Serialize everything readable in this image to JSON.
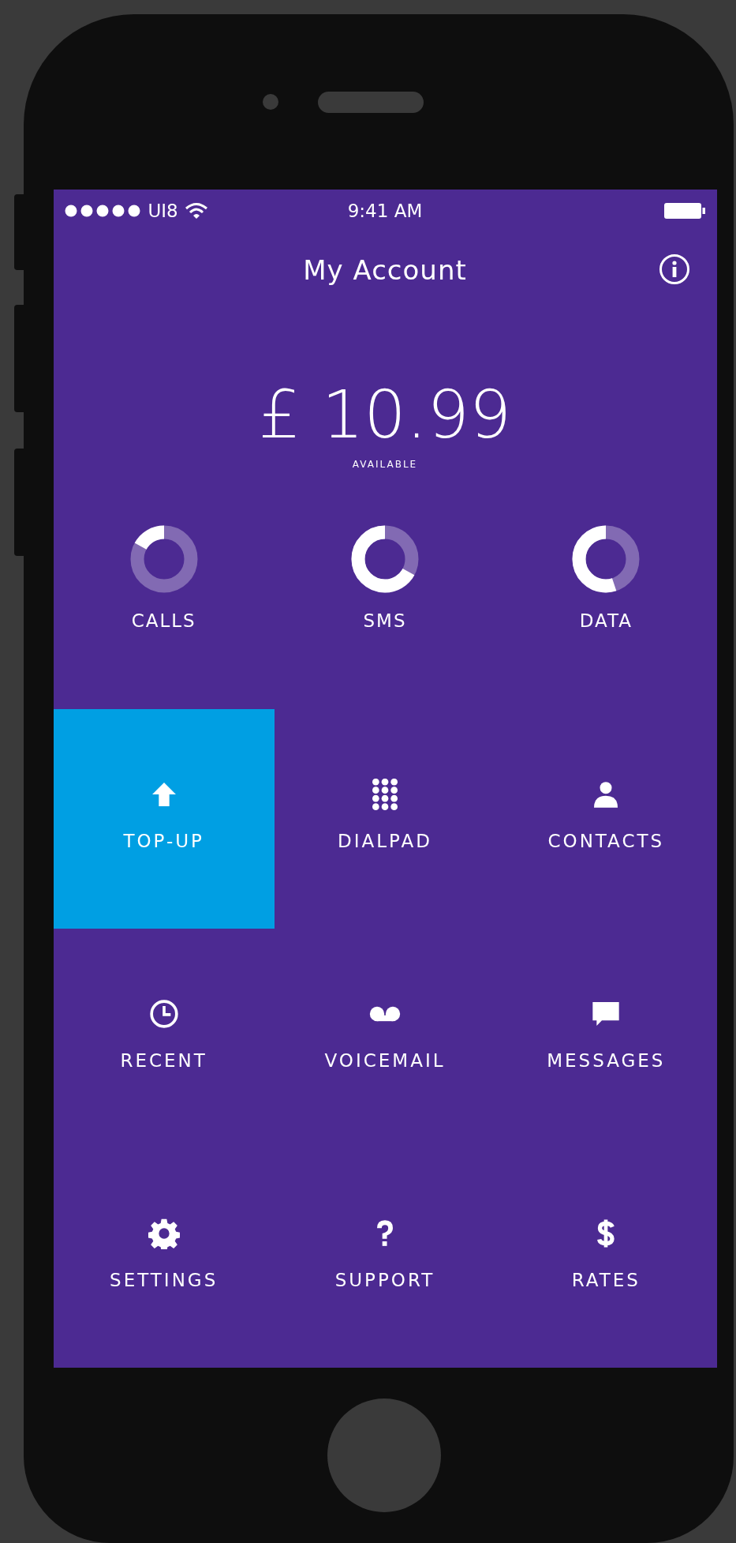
{
  "status_bar": {
    "carrier": "UI8",
    "time": "9:41 AM"
  },
  "header": {
    "title": "My Account"
  },
  "balance": {
    "amount": "£ 10.99",
    "caption": "AVAILABLE"
  },
  "usage": [
    {
      "label": "CALLS",
      "level": 0.17
    },
    {
      "label": "SMS",
      "level": 0.67
    },
    {
      "label": "DATA",
      "level": 0.55
    }
  ],
  "tiles": [
    {
      "label": "TOP-UP",
      "selected": true
    },
    {
      "label": "DIALPAD",
      "selected": false
    },
    {
      "label": "CONTACTS",
      "selected": false
    },
    {
      "label": "RECENT",
      "selected": false
    },
    {
      "label": "VOICEMAIL",
      "selected": false
    },
    {
      "label": "MESSAGES",
      "selected": false
    },
    {
      "label": "SETTINGS",
      "selected": false
    },
    {
      "label": "SUPPORT",
      "selected": false
    },
    {
      "label": "RATES",
      "selected": false
    }
  ]
}
